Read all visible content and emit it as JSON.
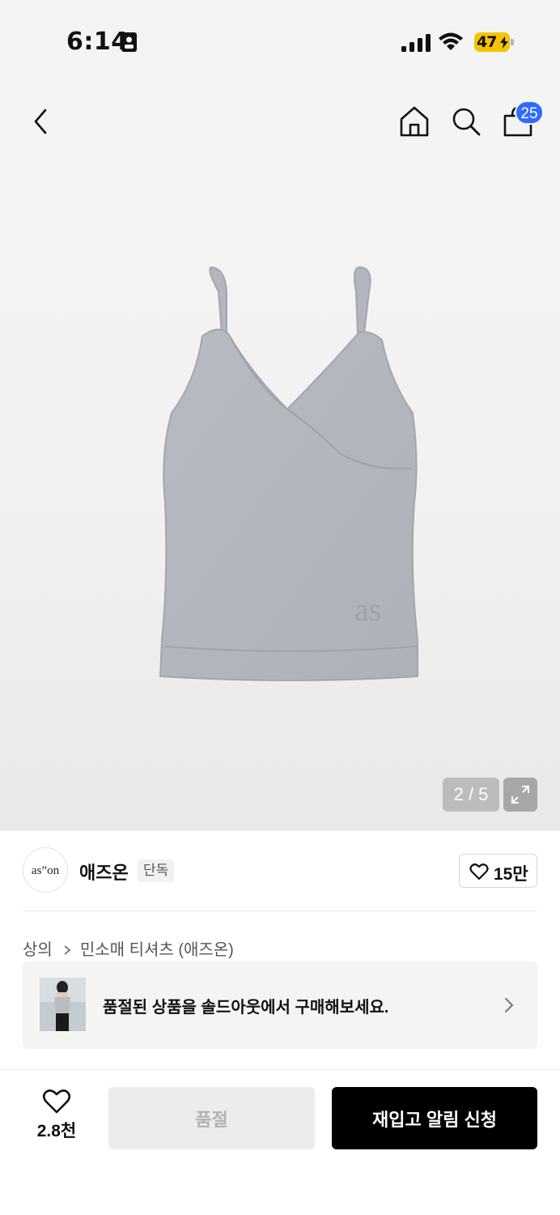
{
  "status_bar": {
    "time": "6:14",
    "battery_percent": "47"
  },
  "header": {
    "cart_count": "25",
    "icons": [
      "back-icon",
      "home-icon",
      "search-icon",
      "cart-icon"
    ]
  },
  "gallery": {
    "counter": "2 / 5",
    "current_image": 2,
    "total_images": 5,
    "print_on_product": "as"
  },
  "brand": {
    "logo_text": "as”on",
    "name": "애즈온",
    "tag": "단독",
    "likes": "15만"
  },
  "breadcrumb": {
    "category": "상의",
    "subcategory": "민소매 티셔츠 (애즈온)"
  },
  "soldout_banner": {
    "text": "품절된 상품을 솔드아웃에서 구매해보세요."
  },
  "bottom_bar": {
    "wish_count": "2.8천",
    "soldout_label": "품절",
    "restock_label": "재입고 알림 신청"
  },
  "colors": {
    "badge": "#2f6bff",
    "battery": "#f5c400",
    "primary_button": "#000000",
    "disabled_button": "#ececec",
    "product": "#b3b6bd"
  }
}
